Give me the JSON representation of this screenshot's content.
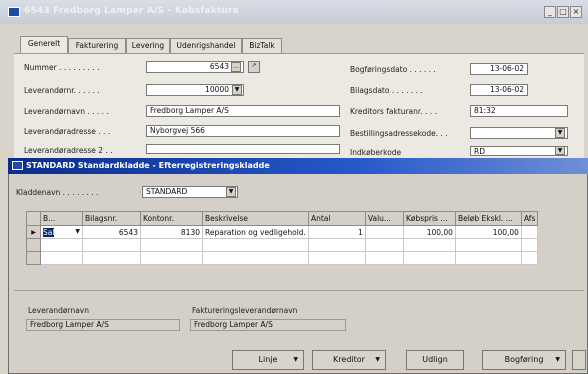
{
  "window1": {
    "title": "6543 Fredborg Lamper A/S - Købsfaktura",
    "controls": [
      "_",
      "□",
      "×"
    ],
    "tabs": [
      {
        "label": "Generelt",
        "active": true
      },
      {
        "label": "Fakturering"
      },
      {
        "label": "Levering"
      },
      {
        "label": "Udenrigshandel"
      },
      {
        "label": "BizTalk"
      }
    ],
    "left_fields": [
      {
        "label": "Nummer . . . . . . . . .",
        "value": "6543"
      },
      {
        "label": "Leverandørnr. . . . . .",
        "value": "10000"
      },
      {
        "label": "Leverandørnavn . . . . .",
        "value": "Fredborg Lamper A/S"
      },
      {
        "label": "Leverandøradresse . . .",
        "value": "Nyborgvej 566"
      },
      {
        "label": "Leverandøradresse 2 . .",
        "value": ""
      }
    ],
    "right_fields": [
      {
        "label": "Bogføringsdato . . . . . .",
        "value": "13-06-02"
      },
      {
        "label": "Bilagsdato . . . . . . .",
        "value": "13-06-02"
      },
      {
        "label": "Kreditors fakturanr. . . .",
        "value": "81:32"
      },
      {
        "label": "Bestillingsadressekode. . .",
        "value": ""
      },
      {
        "label": "Indkøberkode",
        "value": "RD"
      }
    ]
  },
  "window2": {
    "title": "STANDARD Standardkladde - Efterregistreringskladde",
    "kladde_label": "Kladdenavn . . . . . . . .",
    "kladde_value": "STANDARD",
    "columns": [
      "B...",
      "Bilagsnr.",
      "Kontonr.",
      "Beskrivelse",
      "Antal",
      "Valu...",
      "Købspris ...",
      "Beløb Ekskl. ...",
      "Afs"
    ],
    "rows": [
      [
        "Sal",
        "6543",
        "8130",
        "Reparation og vedligehold.",
        "1",
        "",
        "100,00",
        "100,00",
        ""
      ]
    ],
    "footer_labels": [
      "Leverandørnavn",
      "Faktureringsleverandørnavn"
    ],
    "footer_values": [
      "Fredborg Lamper A/S",
      "Fredborg Lamper A/S"
    ],
    "buttons": [
      "Linje",
      "Kreditor",
      "Udlign",
      "Bogføring"
    ]
  }
}
